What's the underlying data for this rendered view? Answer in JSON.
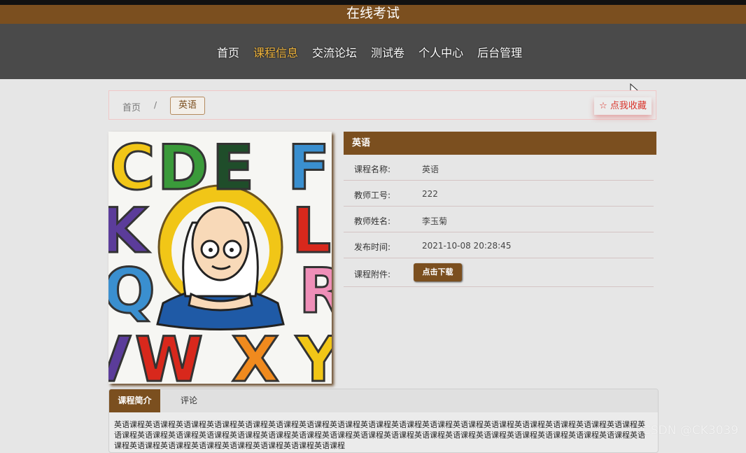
{
  "header": {
    "site_title": "在线考试"
  },
  "nav": {
    "items": [
      {
        "label": "首页",
        "active": false
      },
      {
        "label": "课程信息",
        "active": true
      },
      {
        "label": "交流论坛",
        "active": false
      },
      {
        "label": "测试卷",
        "active": false
      },
      {
        "label": "个人中心",
        "active": false
      },
      {
        "label": "后台管理",
        "active": false
      }
    ]
  },
  "breadcrumb": {
    "home": "首页",
    "separator": "/",
    "current": "英语"
  },
  "favorite": {
    "label": "☆ 点我收藏"
  },
  "cover": {
    "letters_top": "CDEF",
    "letters_row2": [
      "K",
      "L"
    ],
    "letters_row3": [
      "Q",
      "R"
    ],
    "letters_bottom": "VWXY"
  },
  "info": {
    "header": "英语",
    "rows": [
      {
        "label": "课程名称:",
        "value": "英语"
      },
      {
        "label": "教师工号:",
        "value": "222"
      },
      {
        "label": "教师姓名:",
        "value": "李玉菊"
      },
      {
        "label": "发布时间:",
        "value": "2021-10-08 20:28:45"
      }
    ],
    "attachment_label": "课程附件:",
    "download_label": "点击下载"
  },
  "tabs": {
    "intro": "课程简介",
    "comment": "评论"
  },
  "intro_text": "英语课程英语课程英语课程英语课程英语课程英语课程英语课程英语课程英语课程英语课程英语课程英语课程英语课程英语课程英语课程英语课程英语课程英语课程英语课程英语课程英语课程英语课程英语课程英语课程英语课程英语课程英语课程英语课程英语课程英语课程英语课程英语课程英语课程英语课程英语课程英语课程英语课程英语课程英语课程英语课程英语课程英语课程",
  "watermark": "CSDN @CK3039",
  "colors": {
    "brand": "#7b4f1f",
    "nav_bg": "#4a4a4a",
    "nav_active": "#f0b43c",
    "favorite": "#d9342b"
  }
}
